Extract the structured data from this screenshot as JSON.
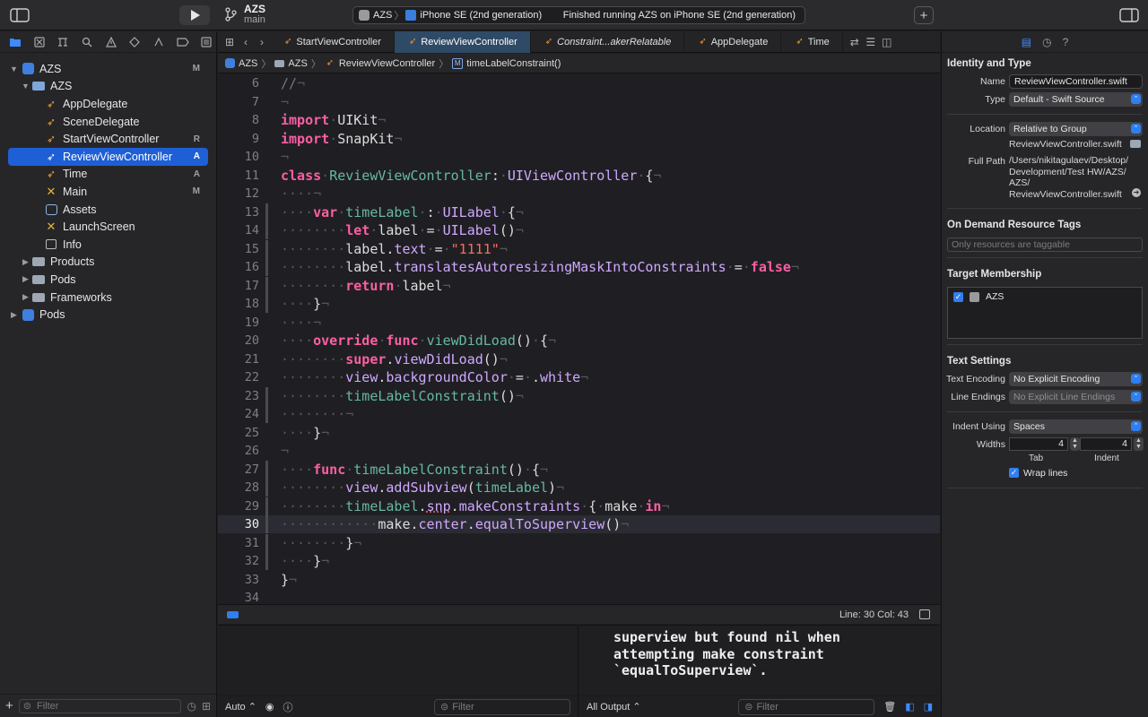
{
  "toolbar": {
    "project": "AZS",
    "branch": "main",
    "scheme": "AZS",
    "destination": "iPhone SE (2nd generation)",
    "status": "Finished running AZS on iPhone SE (2nd generation)"
  },
  "navigator": {
    "items": [
      {
        "label": "AZS",
        "badge": "M"
      },
      {
        "label": "AZS",
        "badge": ""
      },
      {
        "label": "AppDelegate",
        "badge": ""
      },
      {
        "label": "SceneDelegate",
        "badge": ""
      },
      {
        "label": "StartViewController",
        "badge": "R"
      },
      {
        "label": "ReviewViewController",
        "badge": "A"
      },
      {
        "label": "Time",
        "badge": "A"
      },
      {
        "label": "Main",
        "badge": "M"
      },
      {
        "label": "Assets",
        "badge": ""
      },
      {
        "label": "LaunchScreen",
        "badge": ""
      },
      {
        "label": "Info",
        "badge": ""
      },
      {
        "label": "Products",
        "badge": ""
      },
      {
        "label": "Pods",
        "badge": ""
      },
      {
        "label": "Frameworks",
        "badge": ""
      },
      {
        "label": "Pods",
        "badge": ""
      }
    ],
    "filter_placeholder": "Filter"
  },
  "tabs": [
    "StartViewController",
    "ReviewViewController",
    "Constraint...akerRelatable",
    "AppDelegate",
    "Time"
  ],
  "breadcrumb": [
    "AZS",
    "AZS",
    "ReviewViewController",
    "timeLabelConstraint()"
  ],
  "code": {
    "line_numbers": [
      "6",
      "7",
      "8",
      "9",
      "10",
      "11",
      "12",
      "13",
      "14",
      "15",
      "16",
      "17",
      "18",
      "19",
      "20",
      "21",
      "22",
      "23",
      "24",
      "25",
      "26",
      "27",
      "28",
      "29",
      "30",
      "31",
      "32",
      "33",
      "34"
    ],
    "current_line": "30"
  },
  "editor_status": {
    "position": "Line: 30  Col: 43"
  },
  "debug": {
    "variables_mode": "Auto",
    "filter_left": "Filter",
    "output_mode": "All Output",
    "filter_right": "Filter",
    "console_lines": [
      "superview but found nil when",
      "attempting make constraint",
      "`equalToSuperview`."
    ]
  },
  "inspector": {
    "identity_title": "Identity and Type",
    "name_label": "Name",
    "name_value": "ReviewViewController.swift",
    "type_label": "Type",
    "type_value": "Default - Swift Source",
    "location_label": "Location",
    "location_value": "Relative to Group",
    "location_file": "ReviewViewController.swift",
    "fullpath_label": "Full Path",
    "fullpath_value": [
      "/Users/nikitagulaev/Desktop/",
      "Development/Test HW/AZS/",
      "AZS/",
      "ReviewViewController.swift"
    ],
    "tags_title": "On Demand Resource Tags",
    "tags_placeholder": "Only resources are taggable",
    "target_title": "Target Membership",
    "target_item": "AZS",
    "text_title": "Text Settings",
    "encoding_label": "Text Encoding",
    "encoding_value": "No Explicit Encoding",
    "endings_label": "Line Endings",
    "endings_value": "No Explicit Line Endings",
    "indent_label": "Indent Using",
    "indent_value": "Spaces",
    "widths_label": "Widths",
    "tab_width": "4",
    "indent_width": "4",
    "tab_sub": "Tab",
    "indent_sub": "Indent",
    "wrap_label": "Wrap lines"
  }
}
